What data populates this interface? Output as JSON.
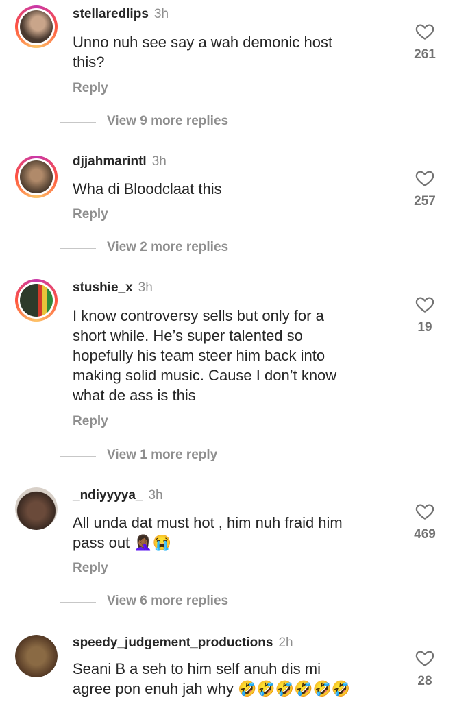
{
  "comments": [
    {
      "username": "stellaredlips",
      "time": "3h",
      "text": "Unno nuh see say a wah demonic host\nthis?",
      "reply_label": "Reply",
      "likes": "261",
      "view_more": "View 9 more replies",
      "avatar_color": "#4a3a30"
    },
    {
      "username": "djjahmarintl",
      "time": "3h",
      "text": "Wha di Bloodclaat this",
      "reply_label": "Reply",
      "likes": "257",
      "view_more": "View 2 more replies",
      "avatar_color": "#6b5440"
    },
    {
      "username": "stushie_x",
      "time": "3h",
      "text": "I know controversy sells but only for a\nshort while. He’s super talented so\nhopefully his team steer him back into\nmaking solid music. Cause I don’t know\nwhat de ass is this",
      "reply_label": "Reply",
      "likes": "19",
      "view_more": "View 1 more reply",
      "avatar_color": "#2e3a2a"
    },
    {
      "username": "_ndiyyyya_",
      "time": "3h",
      "text": "All unda dat must hot , him nuh fraid him\npass out 🤦🏾‍♀️😭",
      "reply_label": "Reply",
      "likes": "469",
      "view_more": "View 6 more replies",
      "avatar_color": "#3a2a22"
    },
    {
      "username": "speedy_judgement_productions",
      "time": "2h",
      "text": "Seani B a seh to him self anuh dis mi\nagree pon enuh jah why 🤣🤣🤣🤣🤣🤣",
      "likes": "28",
      "avatar_color": "#5a3e28"
    }
  ],
  "icons": {
    "like": "heart-outline-icon"
  },
  "colors": {
    "text": "#262626",
    "muted": "#8e8e8e",
    "story_ring": "#c837ab"
  }
}
